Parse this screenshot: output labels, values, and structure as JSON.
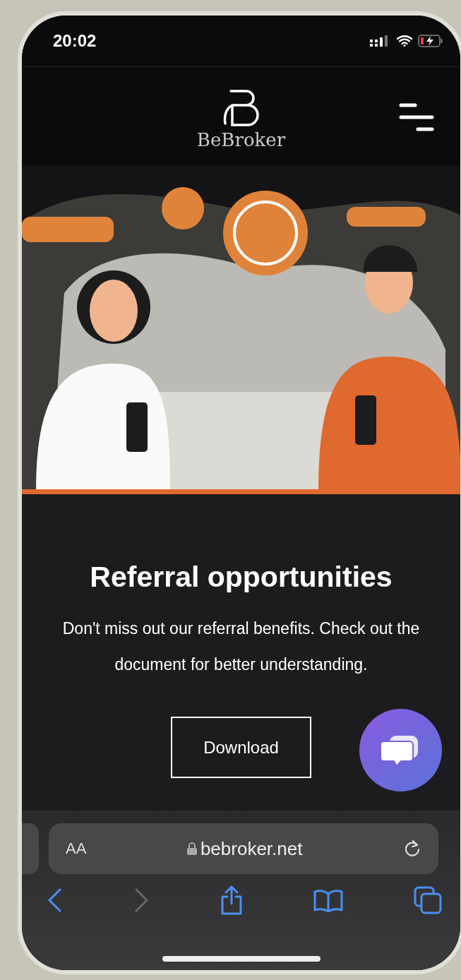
{
  "status_bar": {
    "time": "20:02"
  },
  "header": {
    "brand": "BeBroker"
  },
  "content": {
    "title": "Referral opportunities",
    "text": "Don't miss out our referral benefits. Check out the document for better understanding.",
    "button": "Download"
  },
  "browser": {
    "text_size": "AA",
    "url": "bebroker.net"
  },
  "toolbar": [
    {
      "kind": "back",
      "disabled": false
    },
    {
      "kind": "forward",
      "disabled": true
    },
    {
      "kind": "share",
      "disabled": false
    },
    {
      "kind": "bookmarks",
      "disabled": false
    },
    {
      "kind": "tabs",
      "disabled": false
    }
  ]
}
